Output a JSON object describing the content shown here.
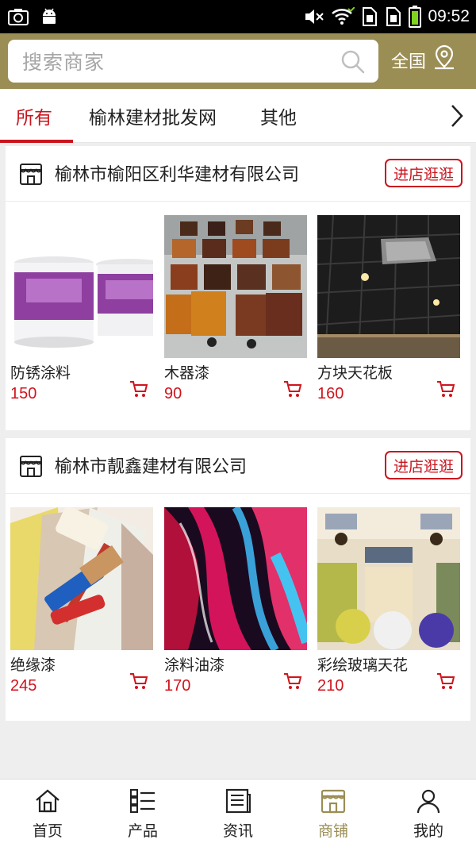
{
  "status_bar": {
    "time": "09:52",
    "left_icons": [
      "screenshot-icon",
      "android-icon"
    ],
    "right_icons": [
      "mute-icon",
      "wifi-icon",
      "sim1-icon",
      "sim2-icon",
      "battery-icon"
    ]
  },
  "header": {
    "search_placeholder": "搜索商家",
    "region_label": "全国",
    "region_icon": "location-pin-icon",
    "background_color": "#9a8e55"
  },
  "tabs": [
    {
      "label": "所有",
      "active": true
    },
    {
      "label": "榆林建材批发网",
      "active": false
    },
    {
      "label": "其他",
      "active": false
    }
  ],
  "accent_color": "#c9151e",
  "shops": [
    {
      "name": "榆林市榆阳区利华建材有限公司",
      "visit_label": "进店逛逛",
      "products": [
        {
          "name": "防锈涂料",
          "price": "150",
          "image": "paint-buckets"
        },
        {
          "name": "木器漆",
          "price": "90",
          "image": "wood-samples"
        },
        {
          "name": "方块天花板",
          "price": "160",
          "image": "ceiling-grid"
        }
      ]
    },
    {
      "name": "榆林市靓鑫建材有限公司",
      "visit_label": "进店逛逛",
      "products": [
        {
          "name": "绝缘漆",
          "price": "245",
          "image": "paint-roller-swatches"
        },
        {
          "name": "涂料油漆",
          "price": "170",
          "image": "liquid-paint-swirl"
        },
        {
          "name": "彩绘玻璃天花",
          "price": "210",
          "image": "decorated-room"
        }
      ]
    }
  ],
  "bottom_nav": [
    {
      "label": "首页",
      "icon": "home-icon",
      "active": false
    },
    {
      "label": "产品",
      "icon": "list-icon",
      "active": false
    },
    {
      "label": "资讯",
      "icon": "news-icon",
      "active": false
    },
    {
      "label": "商铺",
      "icon": "shop-icon",
      "active": true
    },
    {
      "label": "我的",
      "icon": "user-icon",
      "active": false
    }
  ]
}
